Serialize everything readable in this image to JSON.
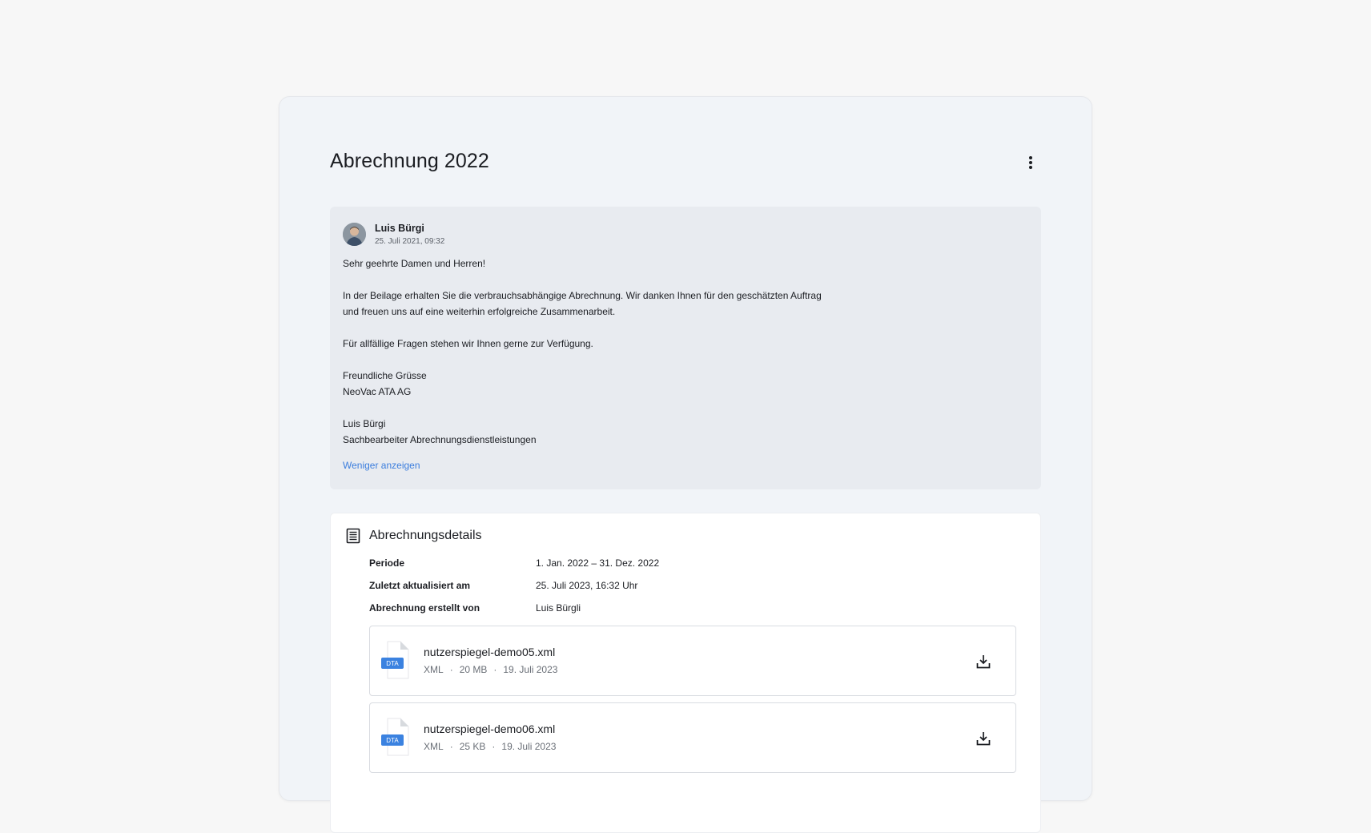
{
  "page": {
    "title": "Abrechnung 2022"
  },
  "message": {
    "author": "Luis Bürgi",
    "date": "25. Juli 2021, 09:32",
    "paragraphs": [
      "Sehr geehrte Damen und Herren!",
      "In der Beilage erhalten Sie die verbrauchsabhängige Abrechnung. Wir danken Ihnen für den geschätzten Auftrag\nund freuen uns auf eine weiterhin erfolgreiche Zusammenarbeit.",
      "Für allfällige Fragen stehen wir Ihnen gerne zur Verfügung.",
      "Freundliche Grüsse\nNeoVac ATA AG",
      "Luis Bürgi\nSachbearbeiter Abrechnungsdienstleistungen"
    ],
    "toggle_label": "Weniger anzeigen"
  },
  "details": {
    "title": "Abrechnungsdetails",
    "rows": [
      {
        "key": "Periode",
        "value": "1. Jan. 2022 – 31. Dez. 2022"
      },
      {
        "key": "Zuletzt aktualisiert am",
        "value": "25. Juli 2023, 16:32 Uhr"
      },
      {
        "key": "Abrechnung erstellt von",
        "value": "Luis Bürgli"
      }
    ],
    "files": [
      {
        "badge": "DTA",
        "name": "nutzerspiegel-demo05.xml",
        "type": "XML",
        "size": "20 MB",
        "date": "19. Juli 2023"
      },
      {
        "badge": "DTA",
        "name": "nutzerspiegel-demo06.xml",
        "type": "XML",
        "size": "25 KB",
        "date": "19. Juli 2023"
      }
    ]
  },
  "icons": {
    "menu": "more-vertical-icon",
    "details": "list-document-icon",
    "download": "download-icon"
  },
  "colors": {
    "accent": "#3b7ddd",
    "badge": "#3b82e0"
  }
}
